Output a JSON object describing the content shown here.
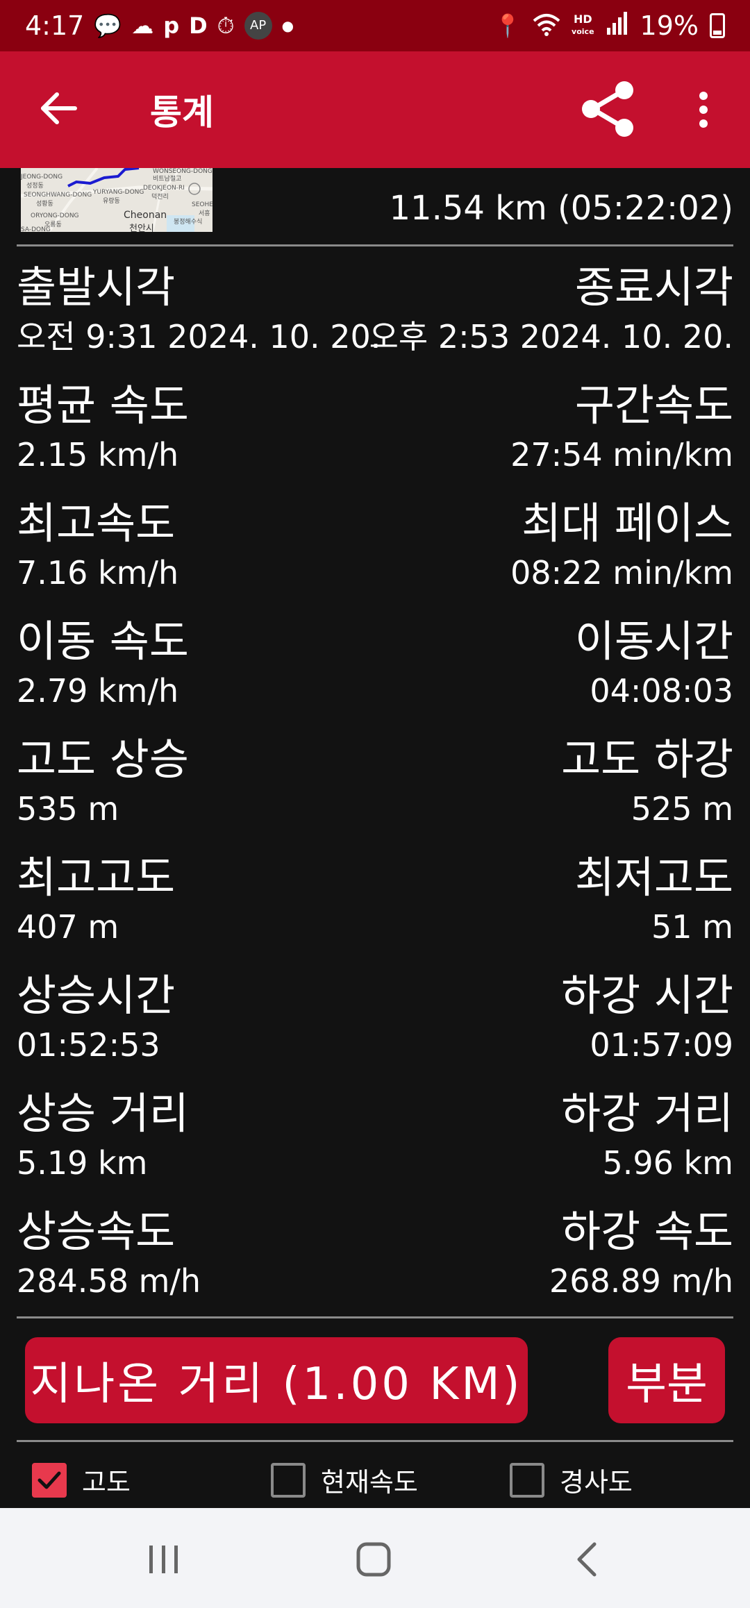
{
  "status_bar": {
    "time": "4:17",
    "battery_percent": "19%",
    "battery_level": 0.19
  },
  "app_bar": {
    "title": "통계"
  },
  "map_thumbnail": {
    "labels": [
      "WONSEONG-DONG",
      "비트남절고",
      "JEONG-DONG",
      "성정동",
      "YURYANG-DONG",
      "유량동",
      "DEOKJEON-RI",
      "덕전리",
      "SEONGHWANG-DONG",
      "성황동",
      "Cheonan",
      "천안시",
      "ORYONG-DONG",
      "오룡동",
      "SEOHEU",
      "서흥",
      "SA-DONG",
      "봉정해수식"
    ]
  },
  "summary": {
    "distance_time": "11.54 km (05:22:02)"
  },
  "stats": [
    {
      "left_label": "출발시각",
      "left_value": "오전 9:31 2024. 10. 20.",
      "right_label": "종료시각",
      "right_value": "오후 2:53 2024. 10. 20."
    },
    {
      "left_label": "평균 속도",
      "left_value": "2.15 km/h",
      "right_label": "구간속도",
      "right_value": "27:54 min/km"
    },
    {
      "left_label": "최고속도",
      "left_value": "7.16 km/h",
      "right_label": "최대 페이스",
      "right_value": "08:22 min/km"
    },
    {
      "left_label": "이동 속도",
      "left_value": "2.79 km/h",
      "right_label": "이동시간",
      "right_value": "04:08:03"
    },
    {
      "left_label": "고도 상승",
      "left_value": "535 m",
      "right_label": "고도 하강",
      "right_value": "525 m"
    },
    {
      "left_label": "최고고도",
      "left_value": "407 m",
      "right_label": "최저고도",
      "right_value": "51 m"
    },
    {
      "left_label": "상승시간",
      "left_value": "01:52:53",
      "right_label": "하강 시간",
      "right_value": "01:57:09"
    },
    {
      "left_label": "상승 거리",
      "left_value": "5.19 km",
      "right_label": "하강 거리",
      "right_value": "5.96 km"
    },
    {
      "left_label": "상승속도",
      "left_value": "284.58 m/h",
      "right_label": "하강 속도",
      "right_value": "268.89 m/h"
    }
  ],
  "buttons": {
    "distance": "지나온 거리 (1.00  KM)",
    "partial": "부분"
  },
  "checkboxes": [
    {
      "label": "고도",
      "checked": true
    },
    {
      "label": "현재속도",
      "checked": false
    },
    {
      "label": "경사도",
      "checked": false
    }
  ],
  "colors": {
    "accent": "#c4102e",
    "status_bar": "#8a0010",
    "background": "#121212",
    "checkbox_checked": "#e8394d"
  },
  "icons": {
    "back": "arrow-left-icon",
    "share": "share-icon",
    "more": "more-vert-icon",
    "nav_recents": "recents-icon",
    "nav_home": "home-icon",
    "nav_back": "back-icon"
  }
}
